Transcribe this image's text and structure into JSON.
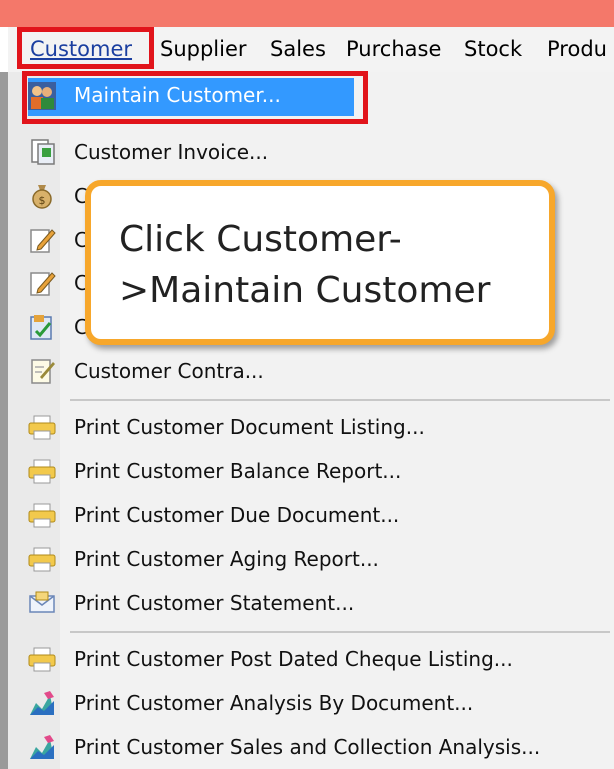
{
  "menubar": {
    "items": [
      {
        "label": "Customer"
      },
      {
        "label": "Supplier"
      },
      {
        "label": "Sales"
      },
      {
        "label": "Purchase"
      },
      {
        "label": "Stock"
      },
      {
        "label": "Produ"
      }
    ]
  },
  "dropdown": {
    "items": [
      {
        "label": "Maintain Customer...",
        "icon": "people-icon"
      },
      {
        "label": "Customer Invoice...",
        "icon": "invoice-icon"
      },
      {
        "label": "C",
        "icon": "money-bag-icon"
      },
      {
        "label": "C",
        "icon": "pencil-note-icon"
      },
      {
        "label": "C",
        "icon": "pencil-note-icon"
      },
      {
        "label": "C",
        "icon": "edit-check-icon"
      },
      {
        "label": "Customer Contra...",
        "icon": "contra-note-icon"
      },
      {
        "label": "Print Customer Document Listing...",
        "icon": "printer-icon"
      },
      {
        "label": "Print Customer Balance Report...",
        "icon": "printer-icon"
      },
      {
        "label": "Print Customer Due Document...",
        "icon": "printer-icon"
      },
      {
        "label": "Print Customer Aging Report...",
        "icon": "printer-icon"
      },
      {
        "label": "Print Customer Statement...",
        "icon": "envelope-icon"
      },
      {
        "label": "Print Customer Post Dated Cheque Listing...",
        "icon": "printer-icon"
      },
      {
        "label": "Print Customer Analysis By Document...",
        "icon": "analysis-chart-icon"
      },
      {
        "label": "Print Customer Sales and Collection Analysis...",
        "icon": "analysis-chart-icon"
      }
    ]
  },
  "callout": {
    "text": "Click Customer-\n>Maintain Customer"
  },
  "colors": {
    "highlight_red": "#e1141b",
    "selection_blue": "#3399ff",
    "callout_orange": "#f7a72b",
    "title_strip": "#f4786a"
  }
}
